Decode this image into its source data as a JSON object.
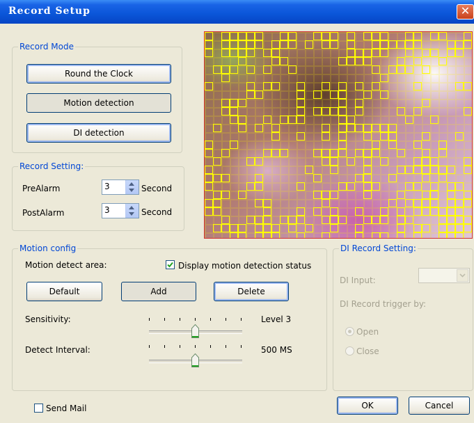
{
  "window": {
    "title": "Record Setup",
    "close_label": "✕"
  },
  "record_mode": {
    "legend": "Record Mode",
    "buttons": [
      "Round the Clock",
      "Motion detection",
      "DI detection"
    ]
  },
  "record_setting": {
    "legend": "Record Setting:",
    "prealarm": {
      "label": "PreAlarm",
      "value": "3",
      "unit": "Second"
    },
    "postalarm": {
      "label": "PostAlarm",
      "value": "3",
      "unit": "Second"
    }
  },
  "motion_config": {
    "legend": "Motion config",
    "area_label": "Motion detect area:",
    "display_status_label": "Display motion detection status",
    "display_status_checked": true,
    "buttons": {
      "default": "Default",
      "add": "Add",
      "delete": "Delete"
    },
    "sensitivity": {
      "label": "Sensitivity:",
      "value_text": "Level 3",
      "level": 3,
      "max_level": 6
    },
    "detect_interval": {
      "label": "Detect Interval:",
      "value_text": "500 MS",
      "position": 3,
      "max_position": 6
    }
  },
  "di_record": {
    "legend": "DI Record Setting:",
    "input_label": "DI Input:",
    "input_value": "",
    "trigger_label": "DI Record trigger by:",
    "options": [
      "Open",
      "Close"
    ],
    "selected": "Open"
  },
  "send_mail": {
    "label": "Send Mail",
    "checked": false
  },
  "dialog_buttons": {
    "ok": "OK",
    "cancel": "Cancel"
  },
  "colors": {
    "legend": "#0046d5",
    "detection_grid": "#ffff00",
    "title_bar": "#0a55d8"
  }
}
